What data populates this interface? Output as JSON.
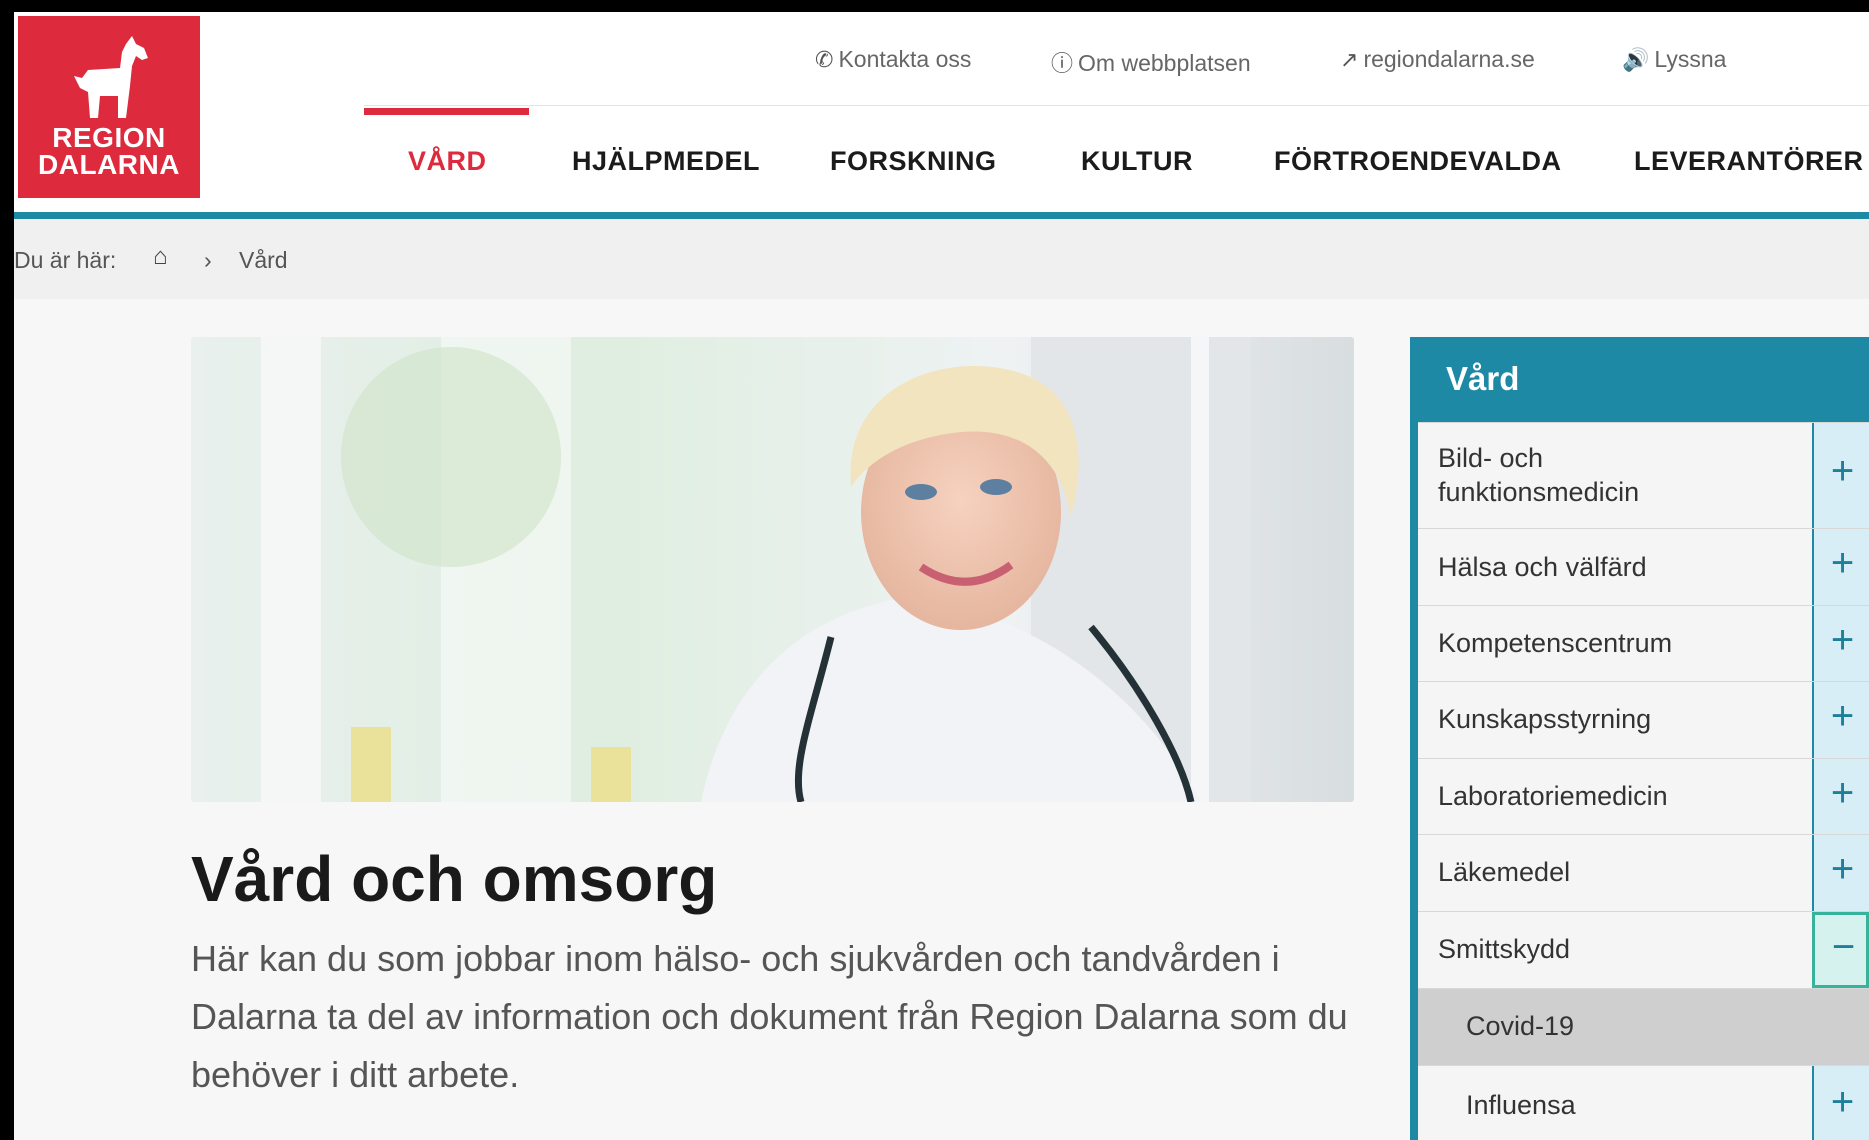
{
  "logo": {
    "line1": "REGION",
    "line2": "DALARNA"
  },
  "utility": {
    "contact": "Kontakta oss",
    "about": "Om webbplatsen",
    "external": "regiondalarna.se",
    "listen": "Lyssna"
  },
  "nav": {
    "items": [
      "VÅRD",
      "HJÄLPMEDEL",
      "FORSKNING",
      "KULTUR",
      "FÖRTROENDEVALDA",
      "LEVERANTÖRER"
    ],
    "active": "VÅRD"
  },
  "breadcrumb": {
    "prefix": "Du är här:",
    "separator": "›",
    "current": "Vård"
  },
  "main": {
    "title": "Vård och omsorg",
    "lead": "Här kan du som jobbar inom hälso- och sjukvården och tandvården i Dalarna ta del av information och dokument från Region Dalarna som du behöver i ditt arbete."
  },
  "sidebar": {
    "heading": "Vård",
    "items": [
      {
        "label": "Bild- och funktionsmedicin",
        "state": "collapsed",
        "symbol": "+"
      },
      {
        "label": "Hälsa och välfärd",
        "state": "collapsed",
        "symbol": "+"
      },
      {
        "label": "Kompetenscentrum",
        "state": "collapsed",
        "symbol": "+"
      },
      {
        "label": "Kunskapsstyrning",
        "state": "collapsed",
        "symbol": "+"
      },
      {
        "label": "Laboratoriemedicin",
        "state": "collapsed",
        "symbol": "+"
      },
      {
        "label": "Läkemedel",
        "state": "collapsed",
        "symbol": "+"
      },
      {
        "label": "Smittskydd",
        "state": "expanded",
        "symbol": "−"
      },
      {
        "label": "Covid-19",
        "state": "child",
        "symbol": ""
      },
      {
        "label": "Influensa",
        "state": "child-collapsed",
        "symbol": "+"
      }
    ]
  },
  "colors": {
    "brand_red": "#dd2a3c",
    "teal": "#1d89a5"
  },
  "icons": [
    "phone-icon",
    "info-icon",
    "external-link-icon",
    "speaker-icon",
    "home-icon",
    "horse-logo-icon"
  ]
}
